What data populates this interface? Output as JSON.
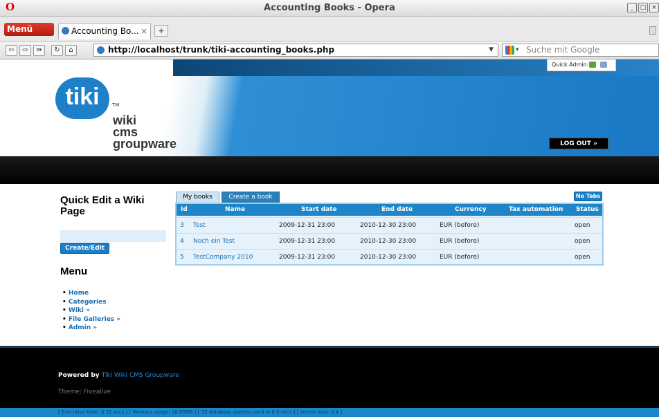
{
  "window": {
    "title": "Accounting Books - Opera",
    "menu_label": "Menü",
    "logo_glyph": "O"
  },
  "browser": {
    "tab_label": "Accounting Bo...",
    "tab_close": "×",
    "newtab": "+",
    "url": "http://localhost/trunk/tiki-accounting_books.php",
    "search_placeholder": "Suche mit Google",
    "nav": {
      "back": "⇦",
      "forward": "⇨",
      "fastforward": "⇛",
      "reload": "↻",
      "home": "⌂"
    }
  },
  "header": {
    "logo_word": "tiki",
    "tm": "TM",
    "logo_lines": [
      "wiki",
      "cms",
      "groupware"
    ],
    "quick_admin": "Quick Admin:",
    "logout": "LOG OUT »"
  },
  "sidebar": {
    "quick_edit_title": "Quick Edit a Wiki Page",
    "create_edit": "Create/Edit",
    "menu_title": "Menu",
    "menu_items": [
      "Home",
      "Categories",
      "Wiki »",
      "File Galleries »",
      "Admin »"
    ]
  },
  "main": {
    "tabs": [
      "My books",
      "Create a book"
    ],
    "no_tabs": "No Tabs",
    "columns": [
      "Id",
      "Name",
      "Start date",
      "End date",
      "Currency",
      "Tax automation",
      "Status"
    ],
    "rows": [
      {
        "id": "3",
        "name": "Test",
        "start": "2009-12-31 23:00",
        "end": "2010-12-30 23:00",
        "currency": "EUR (before)",
        "tax": "",
        "status": "open"
      },
      {
        "id": "4",
        "name": "Noch ein Test",
        "start": "2009-12-31 23:00",
        "end": "2010-12-30 23:00",
        "currency": "EUR (before)",
        "tax": "",
        "status": "open"
      },
      {
        "id": "5",
        "name": "TestCompany 2010",
        "start": "2009-12-31 23:00",
        "end": "2010-12-30 23:00",
        "currency": "EUR (before)",
        "tax": "",
        "status": "open"
      }
    ]
  },
  "footer": {
    "powered_by": "Powered by",
    "powered_link": "Tiki Wiki CMS Groupware",
    "theme": "Theme: Fivealive",
    "status": "[ Execution time: 0.32 secs ]  [ Memory usage: 16.85MB ]  [ 35 database queries used in 0.0 secs ]  [ Server load: 0.4 ]"
  },
  "colors": {
    "accent": "#1e86c8",
    "opera_red": "#d00000",
    "footer_bg": "#000000"
  }
}
